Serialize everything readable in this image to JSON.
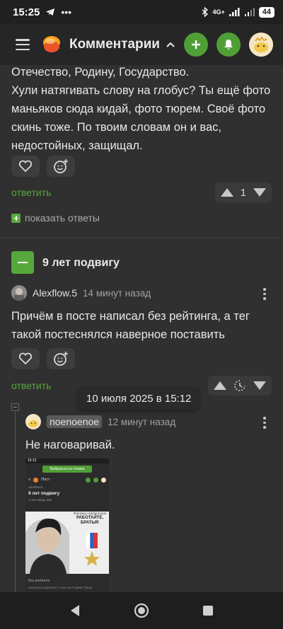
{
  "status_bar": {
    "time": "15:25",
    "network": "4G+",
    "battery": "44"
  },
  "top_bar": {
    "title": "Комментарии"
  },
  "comment1": {
    "text_lines": [
      "Отечество, Родину, Государство.",
      "Хули натягивать слову на глобус? Ты ещё фото маньяков сюда кидай, фото тюрем. Своё фото скинь тоже. По твоим словам он и вас, недостойных, защищал."
    ],
    "reply_label": "ответить",
    "rating": "1",
    "show_replies_label": "показать ответы"
  },
  "post": {
    "title": "9 лет подвигу"
  },
  "comment2": {
    "author": "Alexflow.5",
    "time_ago": "14 минут назад",
    "text": "Причём в посте написал без рейтинга, а тег такой постеснялся наверное поставить",
    "reply_label": "ответить",
    "tooltip": "10 июля 2025 в 15:12"
  },
  "comment3": {
    "author": "noenoenoe",
    "time_ago": "12 минут назад",
    "text": "Не наговаривай."
  },
  "attachment": {
    "status_time": "15:12",
    "banner": "Выбраться из телика",
    "bar_label": "Пост",
    "author": "Alexflow.5",
    "title": "9 лет подвигу",
    "meta": "1 час назад   306",
    "poster_sub": "Магомед Нурбагандов",
    "poster_text": "РАБОТАЙТЕ, БРАТЬЯ!",
    "footer": "Без рейтинга",
    "tags": "Картинка   Картинка с текстом   Подвиг   Герои"
  },
  "colors": {
    "accent": "#57a83b",
    "background": "#303030",
    "topbar": "#262626"
  }
}
